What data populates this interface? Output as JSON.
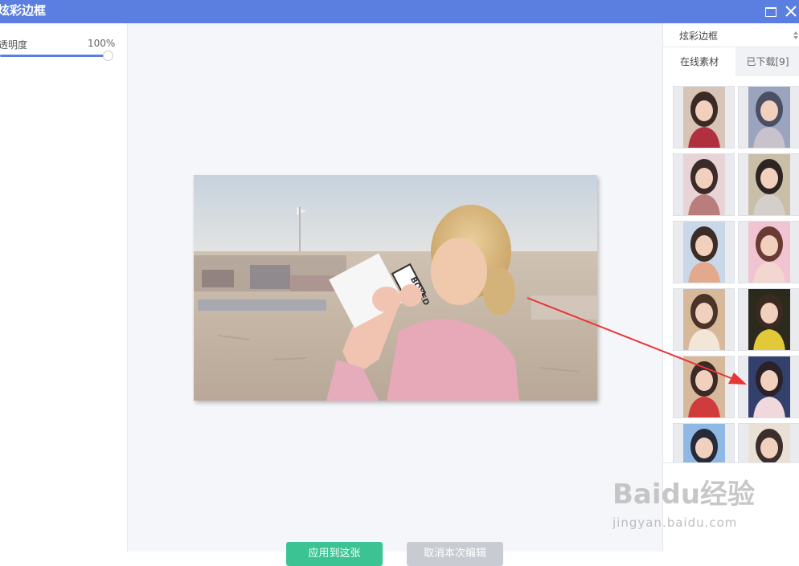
{
  "window": {
    "title": "炫彩边框"
  },
  "left_panel": {
    "opacity_label": "透明度",
    "opacity_value": "100%"
  },
  "canvas": {
    "apply_button": "应用到这张",
    "cancel_button": "取消本次编辑"
  },
  "right_panel": {
    "category_select": "炫彩边框",
    "tabs": [
      {
        "label": "在线素材"
      },
      {
        "label": "已下载[9]"
      }
    ],
    "thumbnails": [
      {
        "name": "frame-thumb-1",
        "colors": [
          "#d7c4b6",
          "#3a2a26",
          "#b03040"
        ]
      },
      {
        "name": "frame-thumb-2",
        "colors": [
          "#9aa4bc",
          "#4b4f66",
          "#c8c2cc"
        ]
      },
      {
        "name": "frame-thumb-3",
        "colors": [
          "#e8d4d6",
          "#3b2b2a",
          "#b97e7c"
        ]
      },
      {
        "name": "frame-thumb-4",
        "colors": [
          "#c9bfa8",
          "#2e2523",
          "#d4cfca"
        ]
      },
      {
        "name": "frame-thumb-5",
        "colors": [
          "#c8d8e8",
          "#3c2c28",
          "#e3a98c"
        ]
      },
      {
        "name": "frame-thumb-6",
        "colors": [
          "#f0c4d0",
          "#6a3b34",
          "#f3d6d0"
        ]
      },
      {
        "name": "frame-thumb-7",
        "colors": [
          "#d7b99a",
          "#4a3328",
          "#f2e6d6"
        ]
      },
      {
        "name": "frame-thumb-8",
        "colors": [
          "#2c2a1c",
          "#3a2a22",
          "#e2c93a"
        ]
      },
      {
        "name": "frame-thumb-9",
        "colors": [
          "#d6b89a",
          "#3c2a26",
          "#d03b3b"
        ]
      },
      {
        "name": "frame-thumb-10",
        "colors": [
          "#34406c",
          "#2a2228",
          "#f0d8dc"
        ]
      },
      {
        "name": "frame-thumb-11",
        "colors": [
          "#8fb9e4",
          "#262a3a",
          "#ffffff"
        ]
      },
      {
        "name": "frame-thumb-12",
        "colors": [
          "#e9e0d6",
          "#3c2e2a",
          "#b59a88"
        ]
      }
    ]
  },
  "watermark": {
    "brand": "Baidu经验",
    "url": "jingyan.baidu.com"
  },
  "colors": {
    "titlebar": "#5a7fe0",
    "apply": "#3cc394",
    "annotation_arrow": "#e83535"
  }
}
